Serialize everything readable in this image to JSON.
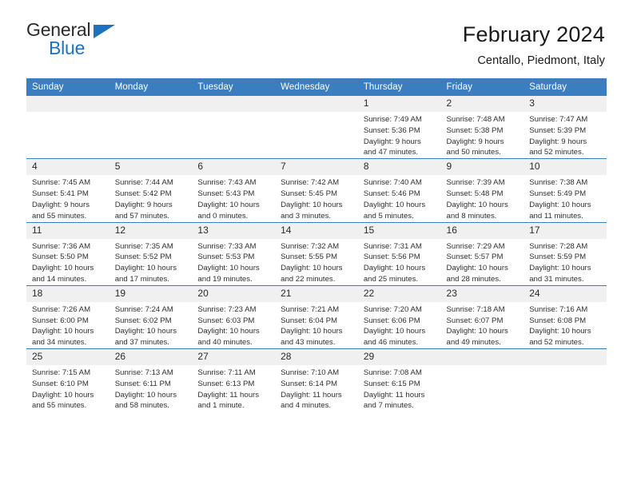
{
  "brand": {
    "name_part1": "General",
    "name_part2": "Blue",
    "accent_color": "#1b72c0"
  },
  "header": {
    "title": "February 2024",
    "subtitle": "Centallo, Piedmont, Italy"
  },
  "calendar": {
    "header_bg": "#3a7ebf",
    "daynum_bg": "#f0f0f0",
    "weekday_headers": [
      "Sunday",
      "Monday",
      "Tuesday",
      "Wednesday",
      "Thursday",
      "Friday",
      "Saturday"
    ],
    "weeks": [
      [
        {
          "day": "",
          "lines": []
        },
        {
          "day": "",
          "lines": []
        },
        {
          "day": "",
          "lines": []
        },
        {
          "day": "",
          "lines": []
        },
        {
          "day": "1",
          "lines": [
            "Sunrise: 7:49 AM",
            "Sunset: 5:36 PM",
            "Daylight: 9 hours",
            "and 47 minutes."
          ]
        },
        {
          "day": "2",
          "lines": [
            "Sunrise: 7:48 AM",
            "Sunset: 5:38 PM",
            "Daylight: 9 hours",
            "and 50 minutes."
          ]
        },
        {
          "day": "3",
          "lines": [
            "Sunrise: 7:47 AM",
            "Sunset: 5:39 PM",
            "Daylight: 9 hours",
            "and 52 minutes."
          ]
        }
      ],
      [
        {
          "day": "4",
          "lines": [
            "Sunrise: 7:45 AM",
            "Sunset: 5:41 PM",
            "Daylight: 9 hours",
            "and 55 minutes."
          ]
        },
        {
          "day": "5",
          "lines": [
            "Sunrise: 7:44 AM",
            "Sunset: 5:42 PM",
            "Daylight: 9 hours",
            "and 57 minutes."
          ]
        },
        {
          "day": "6",
          "lines": [
            "Sunrise: 7:43 AM",
            "Sunset: 5:43 PM",
            "Daylight: 10 hours",
            "and 0 minutes."
          ]
        },
        {
          "day": "7",
          "lines": [
            "Sunrise: 7:42 AM",
            "Sunset: 5:45 PM",
            "Daylight: 10 hours",
            "and 3 minutes."
          ]
        },
        {
          "day": "8",
          "lines": [
            "Sunrise: 7:40 AM",
            "Sunset: 5:46 PM",
            "Daylight: 10 hours",
            "and 5 minutes."
          ]
        },
        {
          "day": "9",
          "lines": [
            "Sunrise: 7:39 AM",
            "Sunset: 5:48 PM",
            "Daylight: 10 hours",
            "and 8 minutes."
          ]
        },
        {
          "day": "10",
          "lines": [
            "Sunrise: 7:38 AM",
            "Sunset: 5:49 PM",
            "Daylight: 10 hours",
            "and 11 minutes."
          ]
        }
      ],
      [
        {
          "day": "11",
          "lines": [
            "Sunrise: 7:36 AM",
            "Sunset: 5:50 PM",
            "Daylight: 10 hours",
            "and 14 minutes."
          ]
        },
        {
          "day": "12",
          "lines": [
            "Sunrise: 7:35 AM",
            "Sunset: 5:52 PM",
            "Daylight: 10 hours",
            "and 17 minutes."
          ]
        },
        {
          "day": "13",
          "lines": [
            "Sunrise: 7:33 AM",
            "Sunset: 5:53 PM",
            "Daylight: 10 hours",
            "and 19 minutes."
          ]
        },
        {
          "day": "14",
          "lines": [
            "Sunrise: 7:32 AM",
            "Sunset: 5:55 PM",
            "Daylight: 10 hours",
            "and 22 minutes."
          ]
        },
        {
          "day": "15",
          "lines": [
            "Sunrise: 7:31 AM",
            "Sunset: 5:56 PM",
            "Daylight: 10 hours",
            "and 25 minutes."
          ]
        },
        {
          "day": "16",
          "lines": [
            "Sunrise: 7:29 AM",
            "Sunset: 5:57 PM",
            "Daylight: 10 hours",
            "and 28 minutes."
          ]
        },
        {
          "day": "17",
          "lines": [
            "Sunrise: 7:28 AM",
            "Sunset: 5:59 PM",
            "Daylight: 10 hours",
            "and 31 minutes."
          ]
        }
      ],
      [
        {
          "day": "18",
          "lines": [
            "Sunrise: 7:26 AM",
            "Sunset: 6:00 PM",
            "Daylight: 10 hours",
            "and 34 minutes."
          ]
        },
        {
          "day": "19",
          "lines": [
            "Sunrise: 7:24 AM",
            "Sunset: 6:02 PM",
            "Daylight: 10 hours",
            "and 37 minutes."
          ]
        },
        {
          "day": "20",
          "lines": [
            "Sunrise: 7:23 AM",
            "Sunset: 6:03 PM",
            "Daylight: 10 hours",
            "and 40 minutes."
          ]
        },
        {
          "day": "21",
          "lines": [
            "Sunrise: 7:21 AM",
            "Sunset: 6:04 PM",
            "Daylight: 10 hours",
            "and 43 minutes."
          ]
        },
        {
          "day": "22",
          "lines": [
            "Sunrise: 7:20 AM",
            "Sunset: 6:06 PM",
            "Daylight: 10 hours",
            "and 46 minutes."
          ]
        },
        {
          "day": "23",
          "lines": [
            "Sunrise: 7:18 AM",
            "Sunset: 6:07 PM",
            "Daylight: 10 hours",
            "and 49 minutes."
          ]
        },
        {
          "day": "24",
          "lines": [
            "Sunrise: 7:16 AM",
            "Sunset: 6:08 PM",
            "Daylight: 10 hours",
            "and 52 minutes."
          ]
        }
      ],
      [
        {
          "day": "25",
          "lines": [
            "Sunrise: 7:15 AM",
            "Sunset: 6:10 PM",
            "Daylight: 10 hours",
            "and 55 minutes."
          ]
        },
        {
          "day": "26",
          "lines": [
            "Sunrise: 7:13 AM",
            "Sunset: 6:11 PM",
            "Daylight: 10 hours",
            "and 58 minutes."
          ]
        },
        {
          "day": "27",
          "lines": [
            "Sunrise: 7:11 AM",
            "Sunset: 6:13 PM",
            "Daylight: 11 hours",
            "and 1 minute."
          ]
        },
        {
          "day": "28",
          "lines": [
            "Sunrise: 7:10 AM",
            "Sunset: 6:14 PM",
            "Daylight: 11 hours",
            "and 4 minutes."
          ]
        },
        {
          "day": "29",
          "lines": [
            "Sunrise: 7:08 AM",
            "Sunset: 6:15 PM",
            "Daylight: 11 hours",
            "and 7 minutes."
          ]
        },
        {
          "day": "",
          "lines": []
        },
        {
          "day": "",
          "lines": []
        }
      ]
    ]
  }
}
